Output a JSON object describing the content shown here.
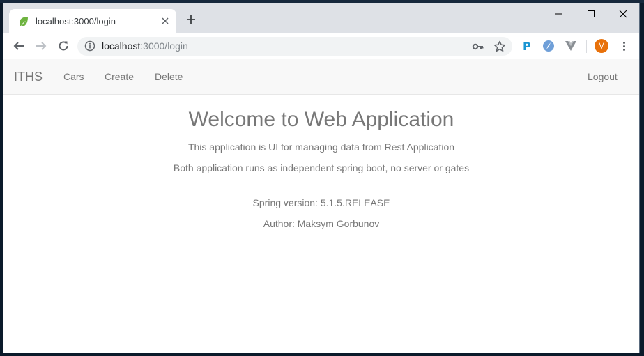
{
  "browser": {
    "tab_title": "localhost:3000/login",
    "url_host": "localhost",
    "url_rest": ":3000/login"
  },
  "navbar": {
    "brand": "ITHS",
    "links": [
      "Cars",
      "Create",
      "Delete"
    ],
    "logout": "Logout"
  },
  "content": {
    "title": "Welcome to Web Application",
    "description": "This application is UI for managing data from Rest Application",
    "description2": "Both application runs as independent spring boot, no server or gates",
    "spring_version": "Spring version: 5.1.5.RELEASE",
    "author": "Author: Maksym Gorbunov"
  },
  "extensions": {
    "avatar_letter": "M"
  },
  "colors": {
    "text_muted": "#777777",
    "avatar": "#e8710a",
    "spring_green": "#6db33f"
  }
}
